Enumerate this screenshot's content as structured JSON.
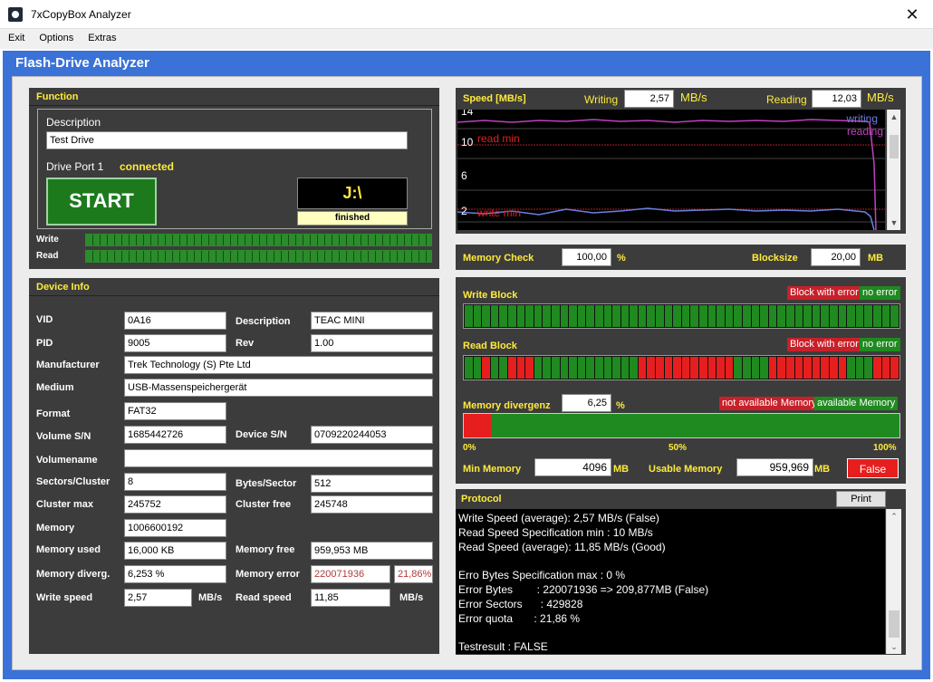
{
  "window": {
    "title": "7xCopyBox Analyzer",
    "close": "✕"
  },
  "menu": [
    "Exit",
    "Options",
    "Extras"
  ],
  "app_title": "Flash-Drive Analyzer",
  "function": {
    "header": "Function",
    "desc_label": "Description",
    "desc_value": "Test Drive",
    "port_label": "Drive Port 1",
    "port_status": "connected",
    "start_label": "START",
    "drive_letter": "J:\\",
    "drive_status": "finished",
    "write_label": "Write",
    "read_label": "Read"
  },
  "device_info": {
    "header": "Device Info",
    "vid_label": "VID",
    "vid": "0A16",
    "description_label": "Description",
    "description": "TEAC MINI",
    "pid_label": "PID",
    "pid": "9005",
    "rev_label": "Rev",
    "rev": "1.00",
    "manufacturer_label": "Manufacturer",
    "manufacturer": "Trek Technology (S) Pte Ltd",
    "medium_label": "Medium",
    "medium": "USB-Massenspeichergerät",
    "format_label": "Format",
    "format": "FAT32",
    "volume_sn_label": "Volume S/N",
    "volume_sn": "1685442726",
    "device_sn_label": "Device S/N",
    "device_sn": "0709220244053",
    "volumename_label": "Volumename",
    "volumename": "",
    "sectors_cluster_label": "Sectors/Cluster",
    "sectors_cluster": "8",
    "bytes_sector_label": "Bytes/Sector",
    "bytes_sector": "512",
    "cluster_max_label": "Cluster max",
    "cluster_max": "245752",
    "cluster_free_label": "Cluster free",
    "cluster_free": "245748",
    "memory_label": "Memory",
    "memory": "1006600192",
    "memory_used_label": "Memory used",
    "memory_used": "16,000 KB",
    "memory_free_label": "Memory free",
    "memory_free": "959,953 MB",
    "memory_diverg_label": "Memory diverg.",
    "memory_diverg": "6,253 %",
    "memory_error_label": "Memory error",
    "memory_error": "220071936",
    "memory_error_pct": "21,86%",
    "write_speed_label": "Write speed",
    "write_speed": "2,57",
    "write_unit": "MB/s",
    "read_speed_label": "Read speed",
    "read_speed": "11,85",
    "read_unit": "MB/s"
  },
  "speed": {
    "header": "Speed [MB/s]",
    "writing_label": "Writing",
    "writing": "2,57",
    "writing_unit": "MB/s",
    "reading_label": "Reading",
    "reading": "12,03",
    "reading_unit": "MB/s",
    "y_ticks": [
      "14",
      "10",
      "6",
      "2"
    ],
    "read_min_label": "read min",
    "write_min_label": "write min",
    "legend_writing": "writing",
    "legend_reading": "reading"
  },
  "memory_check": {
    "label": "Memory Check",
    "value": "100,00",
    "unit": "%",
    "blocksize_label": "Blocksize",
    "blocksize": "20,00",
    "blocksize_unit": "MB"
  },
  "blocks": {
    "write_label": "Write Block",
    "read_label": "Read Block",
    "legend_error": "Block with error",
    "legend_ok": "no error",
    "write_pattern": [
      0,
      0,
      0,
      0,
      0,
      0,
      0,
      0,
      0,
      0,
      0,
      0,
      0,
      0,
      0,
      0,
      0,
      0,
      0,
      0,
      0,
      0,
      0,
      0,
      0,
      0,
      0,
      0,
      0,
      0,
      0,
      0,
      0,
      0,
      0,
      0,
      0,
      0,
      0,
      0,
      0,
      0,
      0,
      0,
      0,
      0,
      0,
      0,
      0,
      0
    ],
    "read_pattern": [
      0,
      0,
      1,
      0,
      0,
      1,
      1,
      1,
      0,
      0,
      0,
      0,
      0,
      0,
      0,
      0,
      0,
      0,
      0,
      0,
      1,
      1,
      1,
      1,
      1,
      1,
      1,
      1,
      1,
      1,
      1,
      0,
      0,
      0,
      0,
      1,
      1,
      1,
      1,
      1,
      1,
      1,
      1,
      1,
      0,
      0,
      0,
      1,
      1,
      1
    ]
  },
  "divergence": {
    "label": "Memory divergenz",
    "value": "6,25",
    "unit": "%",
    "legend_not_available": "not available Memory",
    "legend_available": "available Memory",
    "fill_percent": 6.25,
    "scale": [
      "0%",
      "50%",
      "100%"
    ],
    "min_memory_label": "Min Memory",
    "min_memory": "4096",
    "min_unit": "MB",
    "usable_label": "Usable Memory",
    "usable": "959,969",
    "usable_unit": "MB",
    "result": "False"
  },
  "protocol": {
    "header": "Protocol",
    "print_label": "Print",
    "lines": [
      "Write Speed (average): 2,57 MB/s (False)",
      "Read Speed Specification min : 10 MB/s",
      "Read Speed (average): 11,85 MB/s (Good)",
      "",
      "Erro Bytes Specification max : 0 %",
      "Error Bytes        : 220071936 => 209,877MB (False)",
      "Error Sectors      : 429828",
      "Error quota       : 21,86 %",
      "",
      "Testresult : FALSE"
    ]
  },
  "colors": {
    "frame": "#3a72d8",
    "panel": "#3c3c3c",
    "label": "#ffeb3b",
    "ok": "#1f8a1f",
    "error": "#e61e1e"
  }
}
